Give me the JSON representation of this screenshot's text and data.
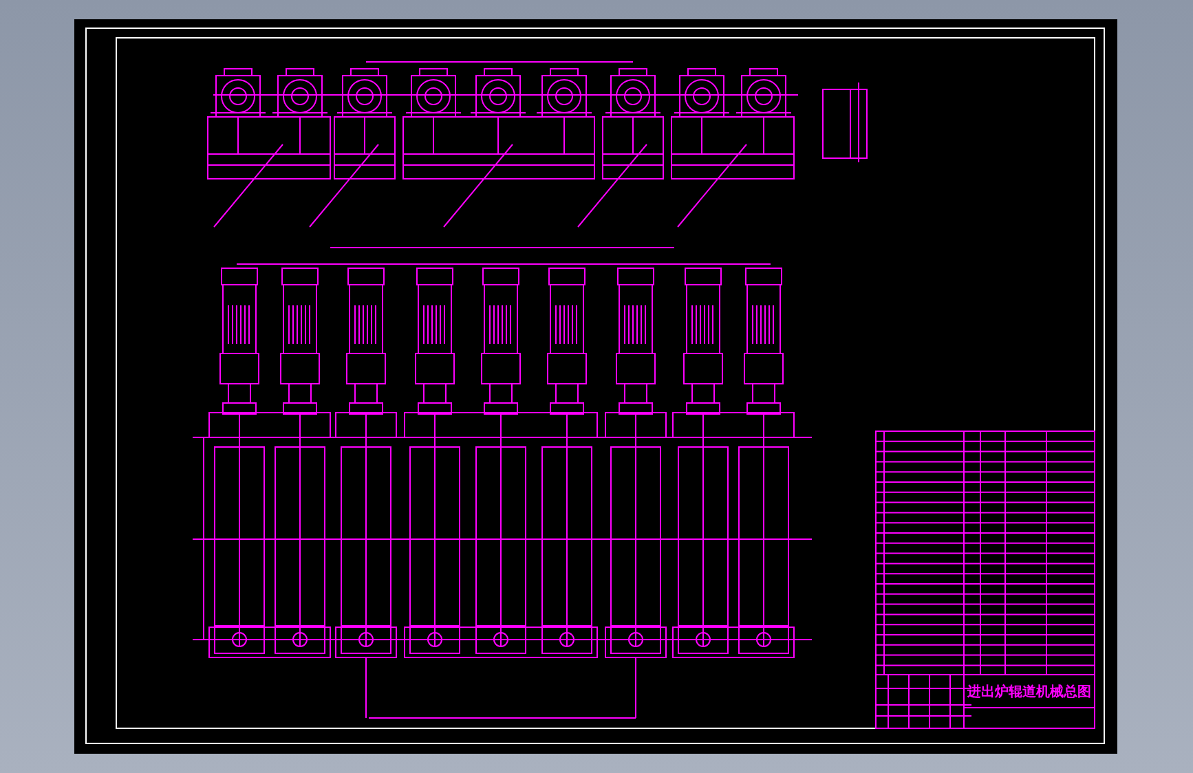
{
  "drawing": {
    "title": "进出炉辊道机械总图"
  }
}
